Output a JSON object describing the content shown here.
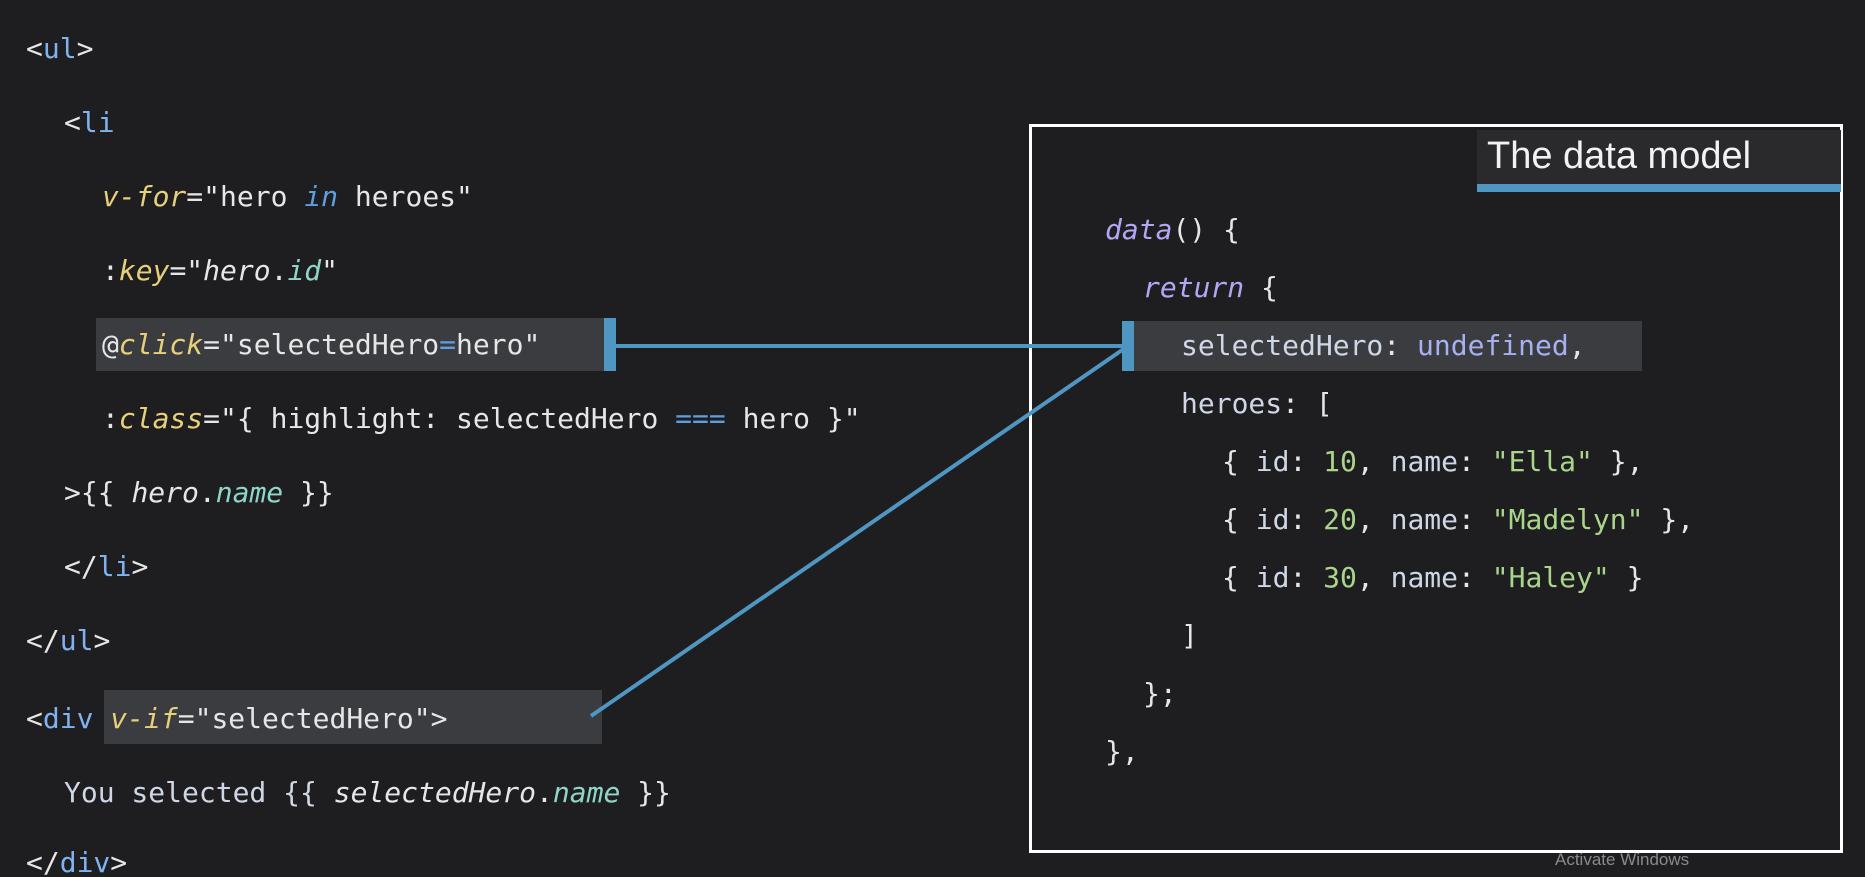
{
  "template_code": {
    "ul_open": {
      "open": "<",
      "tag": "ul",
      "close": ">"
    },
    "li_open": {
      "open": "<",
      "tag": "li"
    },
    "v_for": {
      "attr": "v-for",
      "eq": "=\"",
      "v1": "hero ",
      "kw": "in",
      "v2": " heroes",
      "end": "\""
    },
    "key": {
      "colon": ":",
      "attr": "key",
      "eq": "=\"",
      "obj": "hero",
      "dot": ".",
      "prop": "id",
      "end": "\""
    },
    "click": {
      "at": "@",
      "attr": "click",
      "eq": "=\"",
      "v1": "selectedHero",
      "op": "=",
      "v2": "hero",
      "end": "\""
    },
    "class": {
      "colon": ":",
      "attr": "class",
      "eq": "=\"",
      "brace": "{ ",
      "v1": "highlight: selectedHero ",
      "op": "===",
      "v2": " hero }",
      "end": "\""
    },
    "li_body": {
      "start": ">{{ ",
      "obj": "hero",
      "dot": ".",
      "prop": "name",
      "end": " }}"
    },
    "li_close": {
      "open": "</",
      "tag": "li",
      "close": ">"
    },
    "ul_close": {
      "open": "</",
      "tag": "ul",
      "close": ">"
    },
    "div_open": {
      "open": "<",
      "tag": "div",
      "sp": " ",
      "attr": "v-if",
      "eq": "=\"",
      "v": "selectedHero",
      "end": "\">"
    },
    "div_body": {
      "start": "You selected {{ ",
      "obj": "selectedHero",
      "dot": ".",
      "prop": "name",
      "end": " }}"
    },
    "div_close": {
      "open": "</",
      "tag": "div",
      "close": ">"
    }
  },
  "data_panel": {
    "title": "The data model",
    "code": {
      "l1": {
        "fn": "data",
        "rest": "() {"
      },
      "l2": {
        "kw": "return",
        "rest": " {"
      },
      "l3": {
        "key": "selectedHero",
        "colon": ": ",
        "val": "undefined",
        "comma": ","
      },
      "l4": {
        "key": "heroes",
        "rest": ": ["
      },
      "heroes": [
        {
          "a": "{ ",
          "k1": "id",
          "c1": ": ",
          "id": "10",
          "c2": ", ",
          "k2": "name",
          "c3": ": ",
          "name": "\"Ella\"",
          "end": " },"
        },
        {
          "a": "{ ",
          "k1": "id",
          "c1": ": ",
          "id": "20",
          "c2": ", ",
          "k2": "name",
          "c3": ": ",
          "name": "\"Madelyn\"",
          "end": " },"
        },
        {
          "a": "{ ",
          "k1": "id",
          "c1": ": ",
          "id": "30",
          "c2": ", ",
          "k2": "name",
          "c3": ": ",
          "name": "\"Haley\"",
          "end": " }"
        }
      ],
      "l8": "]",
      "l9": "};",
      "l10": "},"
    }
  },
  "watermark": "Activate Windows",
  "colors": {
    "accent": "#4f96c2",
    "background": "#1e1e20",
    "highlight": "#3a3c40"
  }
}
